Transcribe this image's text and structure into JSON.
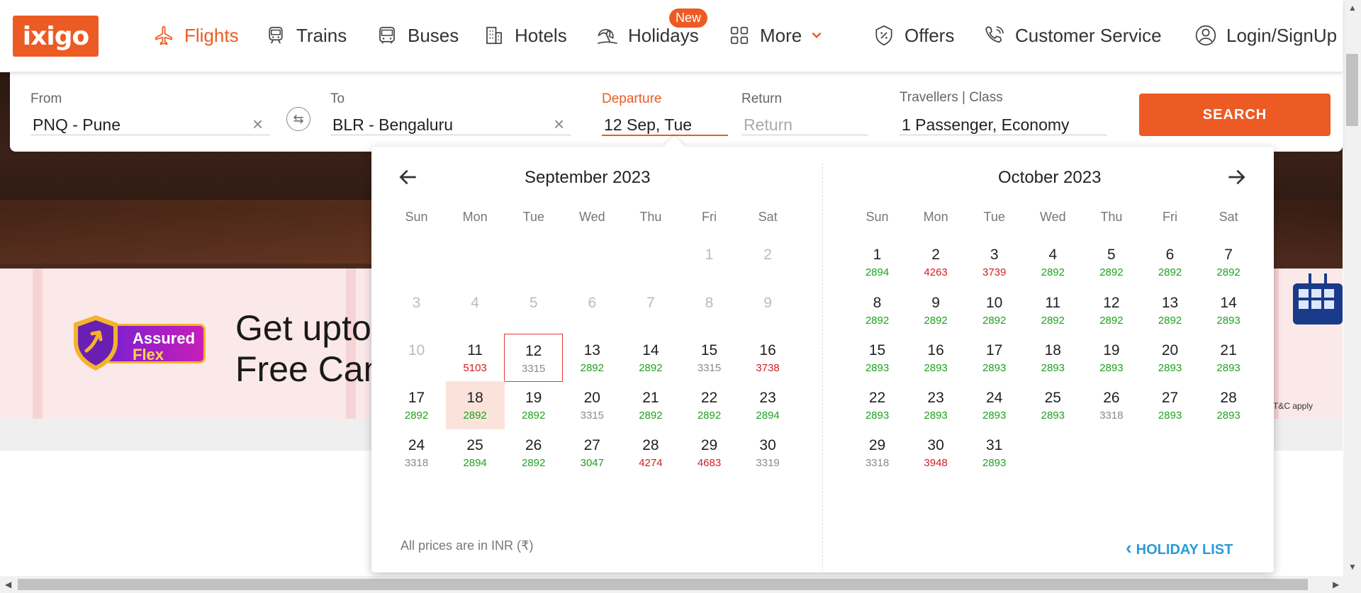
{
  "header": {
    "logo": "ixigo",
    "nav": [
      {
        "label": "Flights",
        "icon": "airplane-icon"
      },
      {
        "label": "Trains",
        "icon": "train-icon"
      },
      {
        "label": "Buses",
        "icon": "bus-icon"
      },
      {
        "label": "Hotels",
        "icon": "hotel-icon"
      },
      {
        "label": "Holidays",
        "icon": "beach-umbrella-icon"
      },
      {
        "label": "More",
        "icon": "grid-icon"
      },
      {
        "label": "Offers",
        "icon": "discount-tag-icon"
      },
      {
        "label": "Customer Service",
        "icon": "phone-icon"
      },
      {
        "label": "Login/SignUp",
        "icon": "user-icon"
      }
    ],
    "new_badge": "New"
  },
  "search": {
    "from_label": "From",
    "from_value": "PNQ - Pune",
    "to_label": "To",
    "to_value": "BLR - Bengaluru",
    "departure_label": "Departure",
    "departure_value": "12 Sep, Tue",
    "return_label": "Return",
    "return_placeholder": "Return",
    "travellers_label": "Travellers | Class",
    "travellers_value": "1 Passenger, Economy",
    "search_button": "SEARCH",
    "clear_symbol": "×"
  },
  "promo": {
    "badge_line1": "Assured",
    "badge_line2": "Flex",
    "text_line1": "Get upto",
    "text_line2": "Free Can",
    "tc": "T&C apply"
  },
  "calendar": {
    "weekdays": [
      "Sun",
      "Mon",
      "Tue",
      "Wed",
      "Thu",
      "Fri",
      "Sat"
    ],
    "footer": "All prices are in INR (₹)",
    "holiday_link": "HOLIDAY LIST",
    "holiday_chevron": "‹",
    "months": [
      {
        "title": "September 2023",
        "days": [
          {
            "d": "1",
            "disabled": true
          },
          {
            "d": "2",
            "disabled": true
          },
          {
            "d": "3",
            "disabled": true
          },
          {
            "d": "4",
            "disabled": true
          },
          {
            "d": "5",
            "disabled": true
          },
          {
            "d": "6",
            "disabled": true
          },
          {
            "d": "7",
            "disabled": true
          },
          {
            "d": "8",
            "disabled": true
          },
          {
            "d": "9",
            "disabled": true
          },
          {
            "d": "10",
            "disabled": true
          },
          {
            "d": "11",
            "p": "5103",
            "c": "red"
          },
          {
            "d": "12",
            "p": "3315",
            "c": "grey",
            "selected": true
          },
          {
            "d": "13",
            "p": "2892",
            "c": "green"
          },
          {
            "d": "14",
            "p": "2892",
            "c": "green"
          },
          {
            "d": "15",
            "p": "3315",
            "c": "grey"
          },
          {
            "d": "16",
            "p": "3738",
            "c": "red"
          },
          {
            "d": "17",
            "p": "2892",
            "c": "green"
          },
          {
            "d": "18",
            "p": "2892",
            "c": "green",
            "hl": true
          },
          {
            "d": "19",
            "p": "2892",
            "c": "green"
          },
          {
            "d": "20",
            "p": "3315",
            "c": "grey"
          },
          {
            "d": "21",
            "p": "2892",
            "c": "green"
          },
          {
            "d": "22",
            "p": "2892",
            "c": "green"
          },
          {
            "d": "23",
            "p": "2894",
            "c": "green"
          },
          {
            "d": "24",
            "p": "3318",
            "c": "grey"
          },
          {
            "d": "25",
            "p": "2894",
            "c": "green"
          },
          {
            "d": "26",
            "p": "2892",
            "c": "green"
          },
          {
            "d": "27",
            "p": "3047",
            "c": "green"
          },
          {
            "d": "28",
            "p": "4274",
            "c": "red"
          },
          {
            "d": "29",
            "p": "4683",
            "c": "red"
          },
          {
            "d": "30",
            "p": "3319",
            "c": "grey"
          }
        ]
      },
      {
        "title": "October 2023",
        "days": [
          {
            "d": "1",
            "p": "2894",
            "c": "green"
          },
          {
            "d": "2",
            "p": "4263",
            "c": "red"
          },
          {
            "d": "3",
            "p": "3739",
            "c": "red"
          },
          {
            "d": "4",
            "p": "2892",
            "c": "green"
          },
          {
            "d": "5",
            "p": "2892",
            "c": "green"
          },
          {
            "d": "6",
            "p": "2892",
            "c": "green"
          },
          {
            "d": "7",
            "p": "2892",
            "c": "green"
          },
          {
            "d": "8",
            "p": "2892",
            "c": "green"
          },
          {
            "d": "9",
            "p": "2892",
            "c": "green"
          },
          {
            "d": "10",
            "p": "2892",
            "c": "green"
          },
          {
            "d": "11",
            "p": "2892",
            "c": "green"
          },
          {
            "d": "12",
            "p": "2892",
            "c": "green"
          },
          {
            "d": "13",
            "p": "2892",
            "c": "green"
          },
          {
            "d": "14",
            "p": "2893",
            "c": "green"
          },
          {
            "d": "15",
            "p": "2893",
            "c": "green"
          },
          {
            "d": "16",
            "p": "2893",
            "c": "green"
          },
          {
            "d": "17",
            "p": "2893",
            "c": "green"
          },
          {
            "d": "18",
            "p": "2893",
            "c": "green"
          },
          {
            "d": "19",
            "p": "2893",
            "c": "green"
          },
          {
            "d": "20",
            "p": "2893",
            "c": "green"
          },
          {
            "d": "21",
            "p": "2893",
            "c": "green"
          },
          {
            "d": "22",
            "p": "2893",
            "c": "green"
          },
          {
            "d": "23",
            "p": "2893",
            "c": "green"
          },
          {
            "d": "24",
            "p": "2893",
            "c": "green"
          },
          {
            "d": "25",
            "p": "2893",
            "c": "green"
          },
          {
            "d": "26",
            "p": "3318",
            "c": "grey"
          },
          {
            "d": "27",
            "p": "2893",
            "c": "green"
          },
          {
            "d": "28",
            "p": "2893",
            "c": "green"
          },
          {
            "d": "29",
            "p": "3318",
            "c": "grey"
          },
          {
            "d": "30",
            "p": "3948",
            "c": "red"
          },
          {
            "d": "31",
            "p": "2893",
            "c": "green"
          }
        ]
      }
    ]
  },
  "colors": {
    "brand": "#ec5b24",
    "price_green": "#1ea21e",
    "price_red": "#d21e1e",
    "link_blue": "#2a9bd8"
  }
}
